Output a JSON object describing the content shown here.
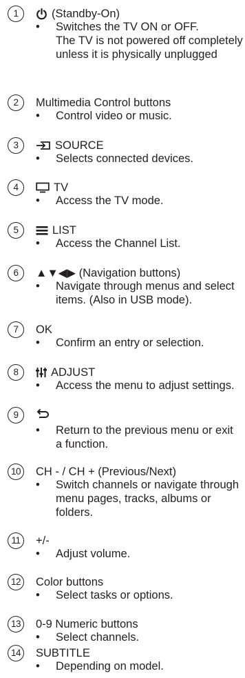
{
  "items": [
    {
      "num": "1",
      "title": "(Standby-On)",
      "icon": "power-icon",
      "desc": "Switches the TV ON or OFF.\nThe TV is not powered off completely\nunless it is physically unplugged"
    },
    {
      "num": "2",
      "title": "Multimedia Control buttons",
      "icon": "",
      "desc": "Control video or music."
    },
    {
      "num": "3",
      "title": "SOURCE",
      "icon": "source-icon",
      "desc": "Selects connected devices."
    },
    {
      "num": "4",
      "title": "TV",
      "icon": "tv-icon",
      "desc": "Access the TV mode."
    },
    {
      "num": "5",
      "title": "LIST",
      "icon": "list-icon",
      "desc": "Access the Channel List."
    },
    {
      "num": "6",
      "title": "▲▼◀▶ (Navigation buttons)",
      "icon": "",
      "desc": "Navigate through menus and select\nitems. (Also in USB mode)."
    },
    {
      "num": "7",
      "title": "OK",
      "icon": "",
      "desc": "Confirm an entry or selection."
    },
    {
      "num": "8",
      "title": "ADJUST",
      "icon": "adjust-icon",
      "desc": "Access the menu to adjust settings."
    },
    {
      "num": "9",
      "title": "",
      "icon": "back-icon",
      "desc": "Return to the previous menu or exit\na function."
    },
    {
      "num": "10",
      "title": "CH - / CH + (Previous/Next)",
      "icon": "",
      "desc": "Switch channels or navigate through\nmenu pages, tracks, albums or\nfolders."
    },
    {
      "num": "11",
      "title": "+/-",
      "icon": "",
      "desc": "Adjust volume."
    },
    {
      "num": "12",
      "title": "Color buttons",
      "icon": "",
      "desc": "Select tasks or options."
    },
    {
      "num": "13",
      "title": "0-9 Numeric buttons",
      "icon": "",
      "desc": "Select channels."
    },
    {
      "num": "14",
      "title": "SUBTITLE",
      "icon": "",
      "desc": "Depending on model."
    }
  ],
  "bullet": "•"
}
